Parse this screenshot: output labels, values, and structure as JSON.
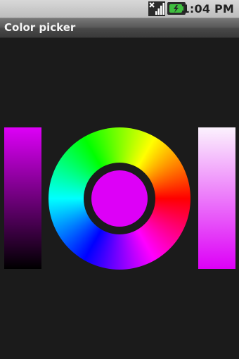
{
  "status_bar": {
    "time": "1:04 PM",
    "icons": [
      "no-sim-signal-icon",
      "battery-charging-icon"
    ]
  },
  "title_bar": {
    "title": "Color picker"
  },
  "picker": {
    "selected_color": "#dd00f7",
    "saturation_top_color": "#fbf2fd",
    "value_bottom_color": "#000000"
  }
}
